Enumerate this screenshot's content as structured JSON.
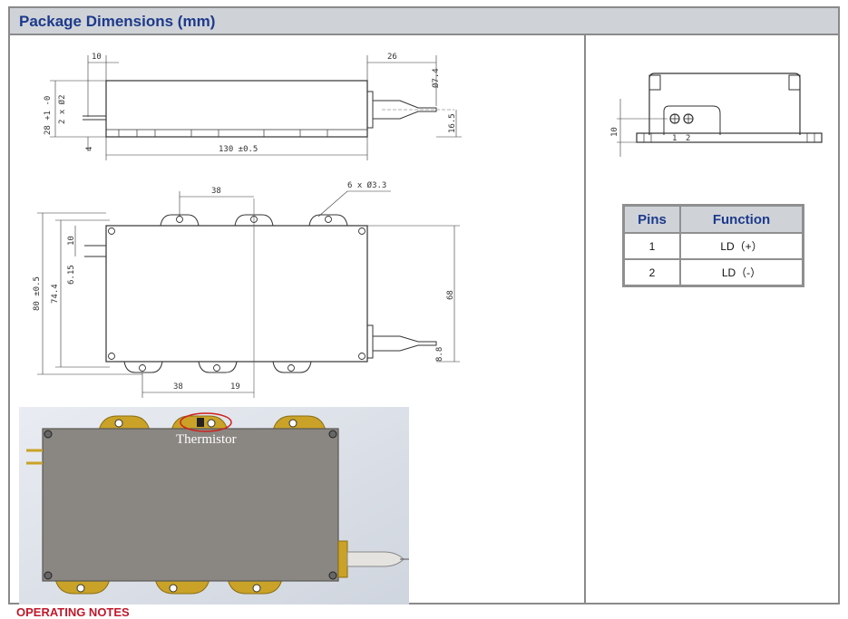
{
  "header": {
    "title": "Package Dimensions (mm)"
  },
  "top_view": {
    "dims": [
      "10",
      "26",
      "Ø7.4",
      "28 +1 -0",
      "2 x Ø2",
      "16.5",
      "4",
      "130 ±0.5"
    ]
  },
  "plan_view": {
    "dims": [
      "38",
      "6 x Ø3.3",
      "10",
      "6.15",
      "80 ±0.5",
      "74.4",
      "68",
      "8.8",
      "38",
      "19"
    ]
  },
  "side_view": {
    "dims": [
      "10",
      "1",
      "2"
    ]
  },
  "photo": {
    "label": "Thermistor"
  },
  "pins_table": {
    "headers": [
      "Pins",
      "Function"
    ],
    "rows": [
      {
        "pin": "1",
        "function": "LD（+）"
      },
      {
        "pin": "2",
        "function": "LD（-）"
      }
    ]
  },
  "footer": {
    "partial_heading": "OPERATING NOTES"
  },
  "colors": {
    "header_bg": "#cfd3d8",
    "title": "#1d3a8a",
    "border": "#8a8a8a",
    "gold": "#c9a227",
    "body_grey": "#8a8782"
  }
}
